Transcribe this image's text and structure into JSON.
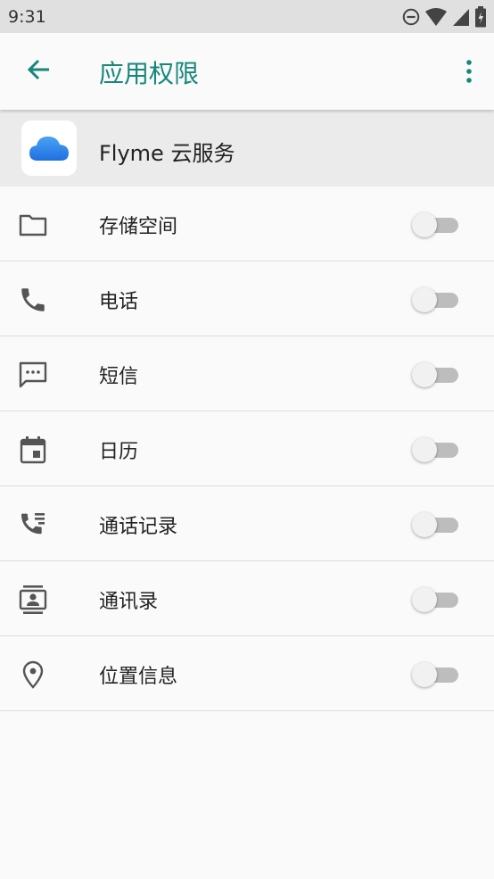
{
  "status_bar": {
    "time": "9:31"
  },
  "app_bar": {
    "title": "应用权限"
  },
  "app": {
    "name": "Flyme 云服务",
    "icon": "cloud-icon"
  },
  "permissions": [
    {
      "label": "存储空间",
      "icon": "folder-icon",
      "enabled": false
    },
    {
      "label": "电话",
      "icon": "phone-icon",
      "enabled": false
    },
    {
      "label": "短信",
      "icon": "sms-icon",
      "enabled": false
    },
    {
      "label": "日历",
      "icon": "calendar-icon",
      "enabled": false
    },
    {
      "label": "通话记录",
      "icon": "call-log-icon",
      "enabled": false
    },
    {
      "label": "通讯录",
      "icon": "contacts-icon",
      "enabled": false
    },
    {
      "label": "位置信息",
      "icon": "location-icon",
      "enabled": false
    }
  ],
  "colors": {
    "accent": "#16877a",
    "app_icon_blue": "#2f7fe8",
    "switch_off_track": "#bdbdbd"
  }
}
